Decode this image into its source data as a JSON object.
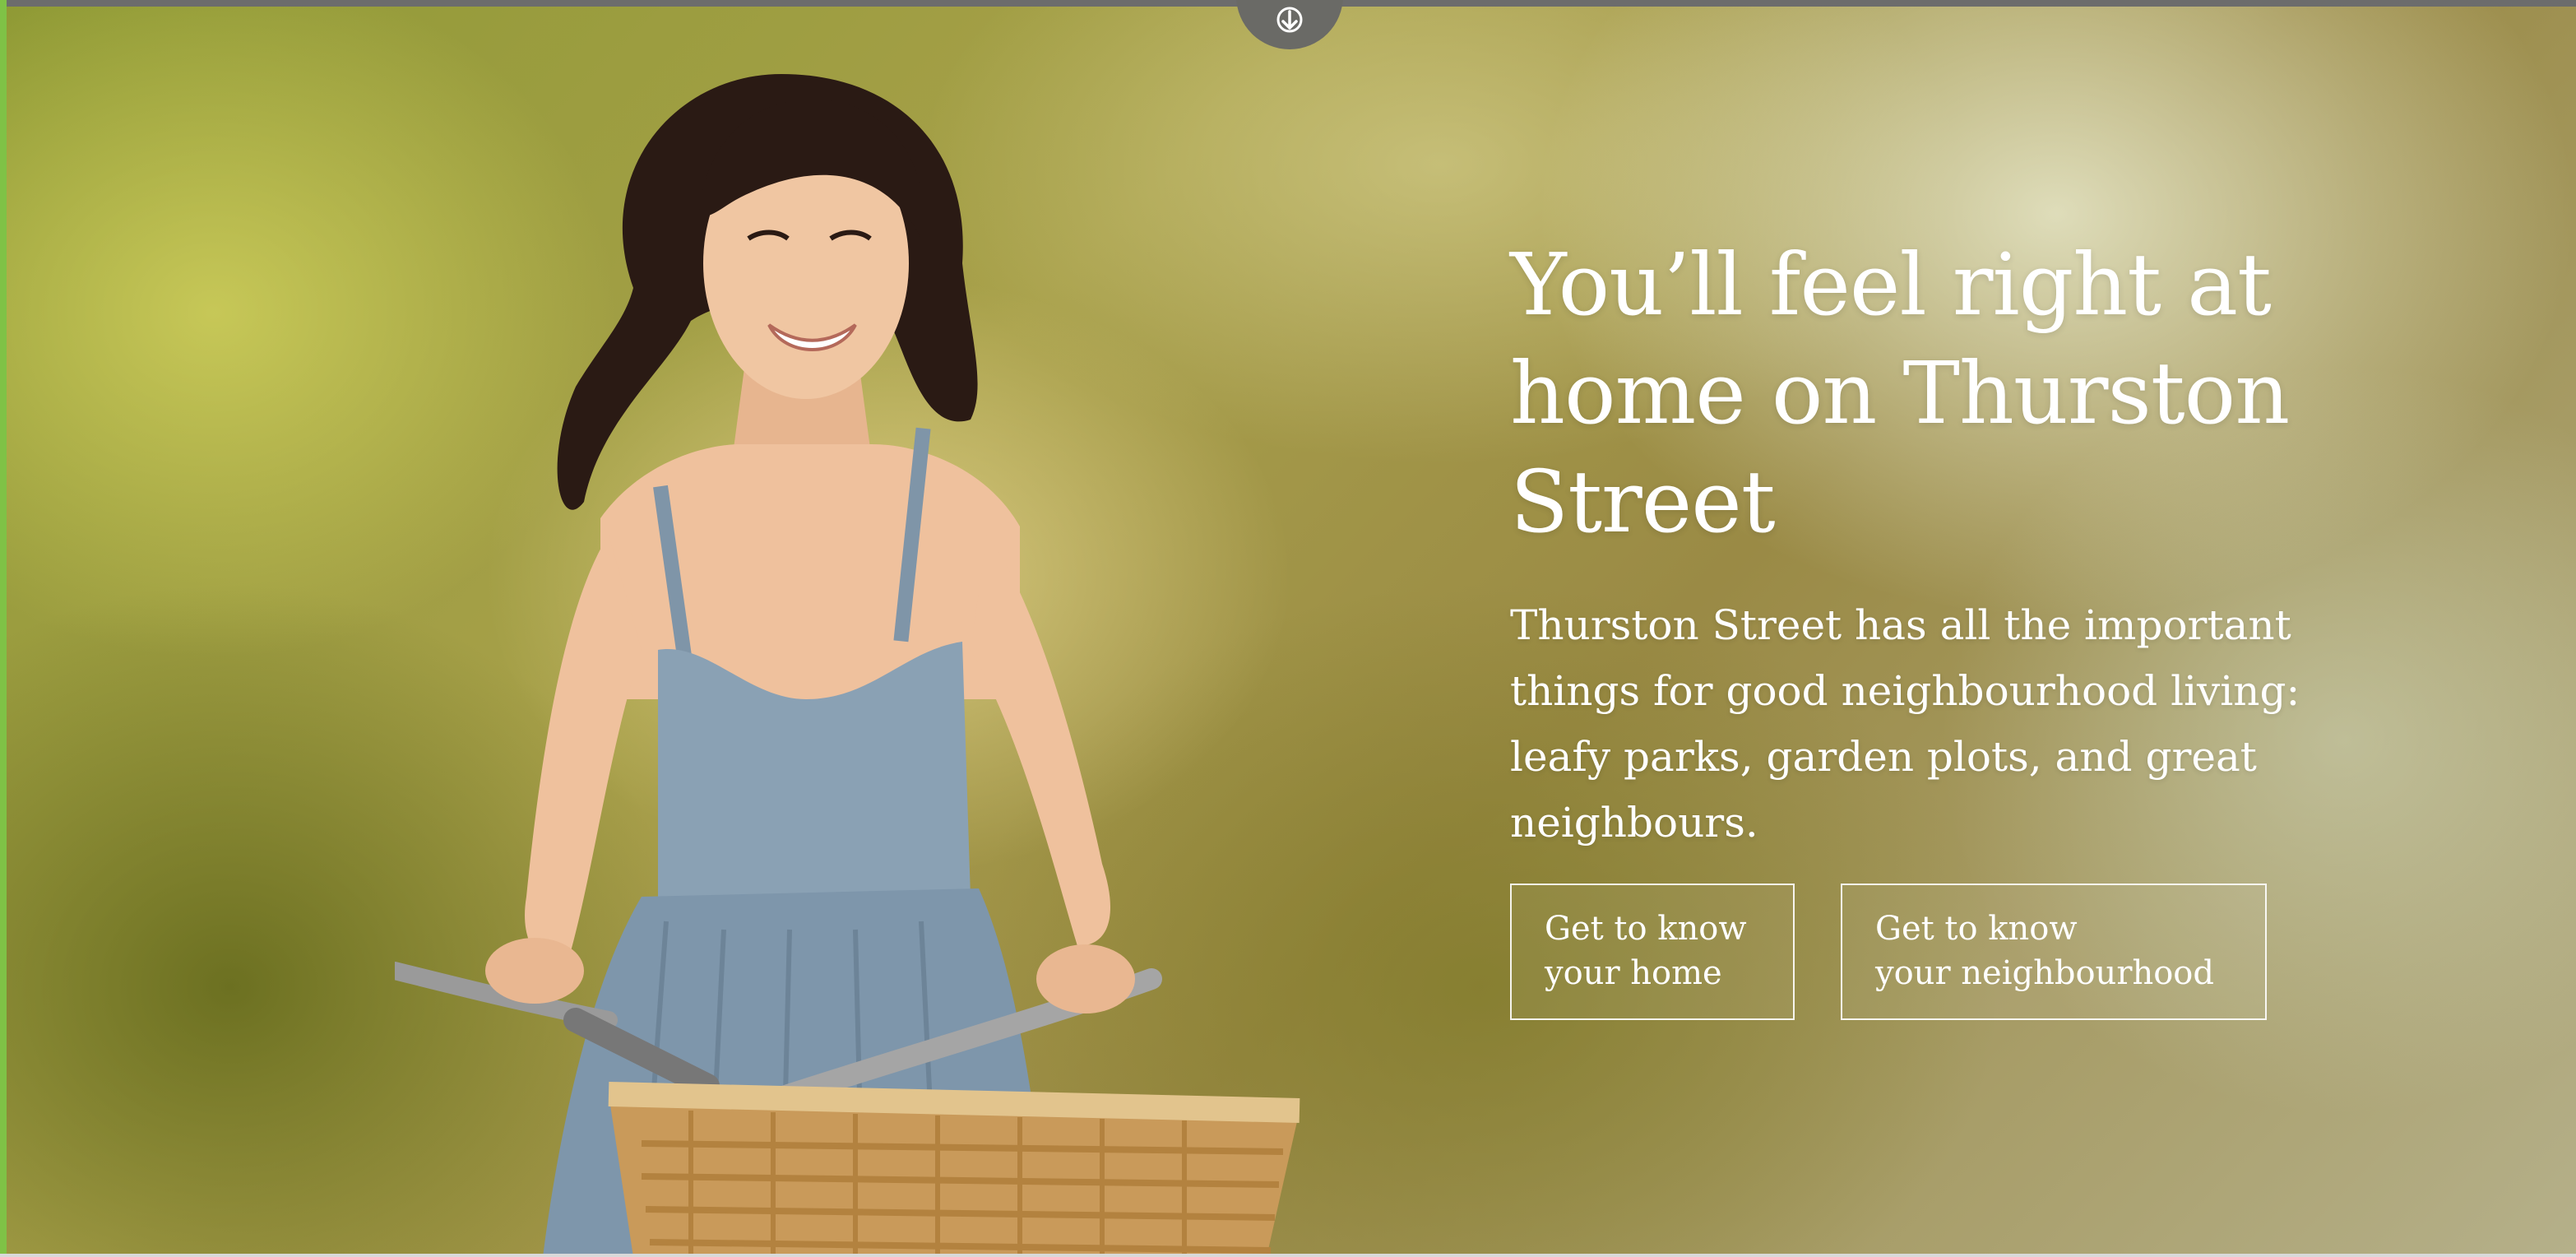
{
  "scroll_tab": {
    "icon": "arrow-down-icon"
  },
  "hero": {
    "headline": "You’ll feel right at home on Thurston Street",
    "body": "Thurston Street has all the important things for good neighbourhood living: leafy parks, garden plots, and great neighbours.",
    "buttons": [
      {
        "line1": "Get to know",
        "line2": "your home"
      },
      {
        "line1": "Get to know",
        "line2": "your neighbourhood"
      }
    ]
  },
  "colors": {
    "accent_edge": "#7fc246",
    "text": "#ffffff",
    "top_bar": "#6c6c6c"
  }
}
